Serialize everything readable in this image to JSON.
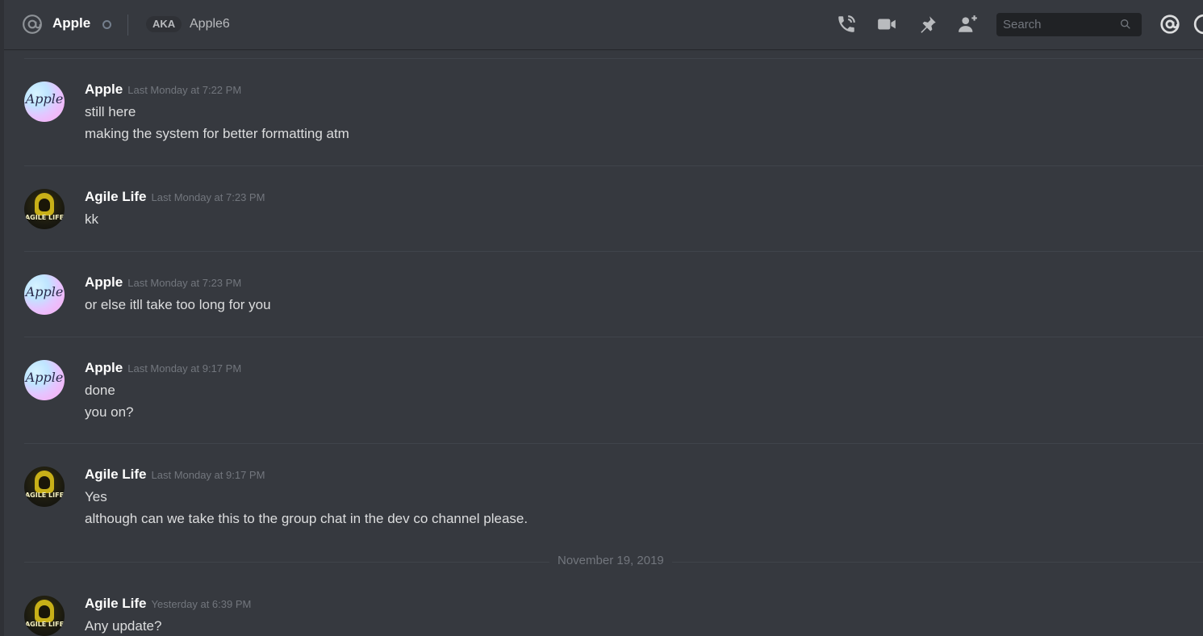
{
  "header": {
    "dm_name": "Apple",
    "aka_label": "AKA",
    "aka_name": "Apple6",
    "search_placeholder": "Search",
    "icons": [
      "at-icon",
      "call-icon",
      "video-icon",
      "pin-icon",
      "add-friend-icon",
      "search-icon",
      "mention-icon",
      "help-icon"
    ]
  },
  "messages": [
    {
      "author": "Apple",
      "avatar_text": "Apple",
      "time": "Last Monday at 7:22 PM",
      "lines": [
        "still here",
        "making the system for better formatting atm"
      ]
    },
    {
      "author": "Agile Life",
      "avatar_text": "AGILE LIFE",
      "time": "Last Monday at 7:23 PM",
      "lines": [
        "kk"
      ]
    },
    {
      "author": "Apple",
      "avatar_text": "Apple",
      "time": "Last Monday at 7:23 PM",
      "lines": [
        "or else itll take too long for you"
      ]
    },
    {
      "author": "Apple",
      "avatar_text": "Apple",
      "time": "Last Monday at 9:17 PM",
      "lines": [
        "done",
        "you on?"
      ]
    },
    {
      "author": "Agile Life",
      "avatar_text": "AGILE LIFE",
      "time": "Last Monday at 9:17 PM",
      "lines": [
        "Yes",
        "although can we take this to the group chat in the dev co channel please."
      ]
    },
    {
      "author": "Agile Life",
      "avatar_text": "AGILE LIFE",
      "time": "Yesterday at 6:39 PM",
      "lines": [
        "Any update?"
      ]
    }
  ],
  "date_divider": "November 19, 2019",
  "colors": {
    "background": "#36393f",
    "text": "#dcddde",
    "username": "#ffffff",
    "muted": "#72767d"
  }
}
